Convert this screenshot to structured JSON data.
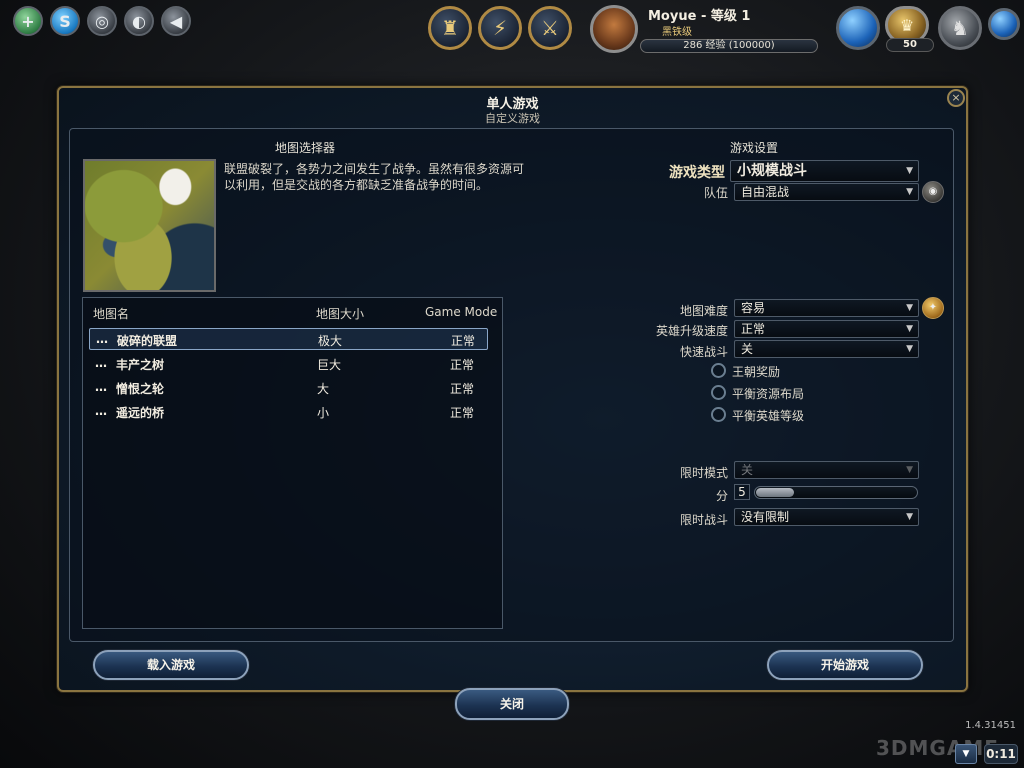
{
  "topbar": {
    "player_name": "Moyue - 等级 1",
    "rank": "黑铁级",
    "xp_text": "286 经验 (100000)",
    "gold": "50"
  },
  "dialog": {
    "title": "单人游戏",
    "subtitle": "自定义游戏",
    "close_symbol": "×"
  },
  "map_selector": {
    "title": "地图选择器",
    "description": "联盟破裂了，各势力之间发生了战争。虽然有很多资源可以利用，但是交战的各方都缺乏准备战争的时间。",
    "columns": [
      "地图名",
      "地图大小",
      "Game Mode"
    ],
    "maps": [
      {
        "dots": "…",
        "name": "破碎的联盟",
        "size": "极大",
        "mode": "正常",
        "selected": true
      },
      {
        "dots": "…",
        "name": "丰产之树",
        "size": "巨大",
        "mode": "正常",
        "selected": false
      },
      {
        "dots": "…",
        "name": "憎恨之轮",
        "size": "大",
        "mode": "正常",
        "selected": false
      },
      {
        "dots": "…",
        "name": "遥远的桥",
        "size": "小",
        "mode": "正常",
        "selected": false
      }
    ]
  },
  "settings": {
    "title": "游戏设置",
    "game_type_label": "游戏类型",
    "game_type_value": "小规模战斗",
    "team_label": "队伍",
    "team_value": "自由混战",
    "difficulty_label": "地图难度",
    "difficulty_value": "容易",
    "hero_speed_label": "英雄升级速度",
    "hero_speed_value": "正常",
    "quick_battle_label": "快速战斗",
    "quick_battle_value": "关",
    "checkboxes": [
      "王朝奖励",
      "平衡资源布局",
      "平衡英雄等级"
    ],
    "time_mode_label": "限时模式",
    "time_mode_value": "关",
    "minutes_label": "分",
    "minutes_value": "5",
    "minutes_slider_fraction": 0.24,
    "battle_time_label": "限时战斗",
    "battle_time_value": "没有限制"
  },
  "buttons": {
    "load_game": "载入游戏",
    "start_game": "开始游戏",
    "close": "关闭"
  },
  "footer": {
    "version": "1.4.31451",
    "watermark": "3DMGAME",
    "timer": "0:11"
  },
  "colors": {
    "panel_bg": "#0e1a28",
    "gold_trim": "#8a7440",
    "button_blue": "#1c3352"
  }
}
